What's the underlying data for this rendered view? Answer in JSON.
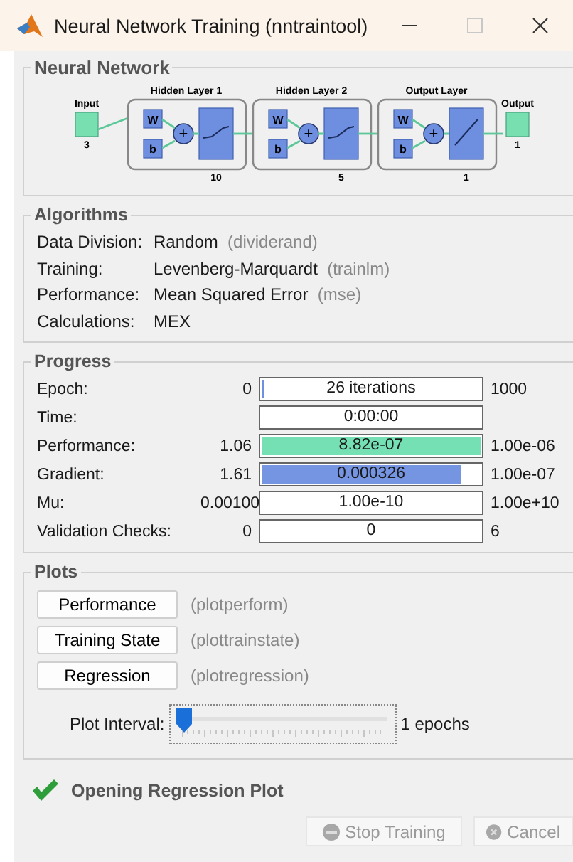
{
  "window": {
    "title": "Neural Network Training (nntraintool)"
  },
  "network": {
    "title": "Neural Network",
    "input": {
      "label": "Input",
      "size": "3"
    },
    "layers": [
      {
        "title": "Hidden Layer 1",
        "weight": "W",
        "bias": "b",
        "sum": "+",
        "size": "10",
        "kind": "tansig"
      },
      {
        "title": "Hidden Layer 2",
        "weight": "W",
        "bias": "b",
        "sum": "+",
        "size": "5",
        "kind": "tansig"
      },
      {
        "title": "Output Layer",
        "weight": "W",
        "bias": "b",
        "sum": "+",
        "size": "1",
        "kind": "purelin"
      }
    ],
    "output": {
      "label": "Output",
      "size": "1"
    }
  },
  "algorithms": {
    "title": "Algorithms",
    "rows": [
      {
        "label": "Data Division:",
        "value": "Random",
        "function": "(dividerand)"
      },
      {
        "label": "Training:",
        "value": "Levenberg-Marquardt",
        "function": "(trainlm)"
      },
      {
        "label": "Performance:",
        "value": "Mean Squared Error",
        "function": "(mse)"
      },
      {
        "label": "Calculations:",
        "value": "MEX"
      }
    ]
  },
  "progress": {
    "title": "Progress",
    "rows": [
      {
        "label": "Epoch:",
        "start": "0",
        "value": "26 iterations",
        "level": 0.026,
        "color": "#6f8fe0",
        "target": "1000"
      },
      {
        "label": "Time:",
        "value": "0:00:00"
      },
      {
        "label": "Performance:",
        "start": "1.06",
        "value": "8.82e-07",
        "level": 1,
        "color": "#74e0b4",
        "target": "1.00e-06"
      },
      {
        "label": "Gradient:",
        "start": "1.61",
        "value": "0.000326",
        "level": 0.91,
        "color": "#7595e3",
        "target": "1.00e-07"
      },
      {
        "label": "Mu:",
        "start": "0.00100",
        "value": "1.00e-10",
        "target": "1.00e+10"
      },
      {
        "label": "Validation Checks:",
        "start": "0",
        "value": "0",
        "target": "6"
      }
    ]
  },
  "plots": {
    "title": "Plots",
    "buttons": [
      {
        "label": "Performance",
        "function": "(plotperform)"
      },
      {
        "label": "Training State",
        "function": "(plottrainstate)"
      },
      {
        "label": "Regression",
        "function": "(plotregression)"
      }
    ],
    "interval": {
      "label": "Plot Interval:",
      "level": 0,
      "reading": "1 epochs"
    }
  },
  "status": {
    "text": "Opening Regression Plot"
  },
  "buttons": [
    {
      "label": "Stop Training",
      "kind": "stop",
      "disabled": true
    },
    {
      "label": "Cancel",
      "kind": "cancel",
      "disabled": true
    }
  ]
}
